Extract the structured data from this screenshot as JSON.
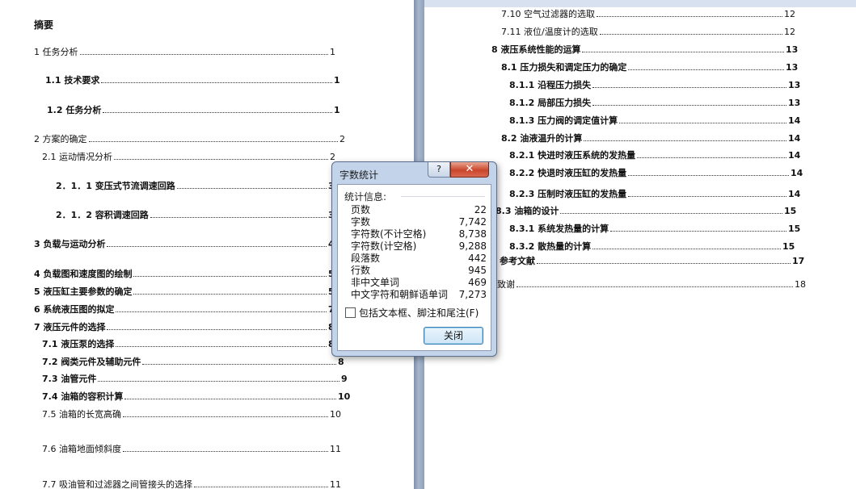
{
  "document": {
    "abstract_heading": "摘要",
    "left_entries": [
      {
        "title": "1 任务分析",
        "page": "1"
      },
      {
        "title": "1.1 技术要求",
        "page": "1"
      },
      {
        "title": "1.2  任务分析",
        "page": "1"
      },
      {
        "title": "2   方案的确定",
        "page": "2"
      },
      {
        "title": "2.1 运动情况分析",
        "page": "2"
      },
      {
        "title": "2．1．1 变压式节流调速回路",
        "page": "3"
      },
      {
        "title": "2．1．2 容积调速回路",
        "page": "3"
      },
      {
        "title": "3   负载与运动分析",
        "page": "4"
      },
      {
        "title": "4   负载图和速度图的绘制",
        "page": "5"
      },
      {
        "title": "5 液压缸主要参数的确定",
        "page": "5"
      },
      {
        "title": "6 系统液压图的拟定",
        "page": "7"
      },
      {
        "title": "7 液压元件的选择",
        "page": "8"
      },
      {
        "title": "7.1 液压泵的选择",
        "page": "8"
      },
      {
        "title": "7.2  阀类元件及辅助元件",
        "page": "8"
      },
      {
        "title": "7.3 油管元件",
        "page": "9"
      },
      {
        "title": "7.4 油箱的容积计算",
        "page": "10"
      },
      {
        "title": "7.5 油箱的长宽高确",
        "page": "10"
      },
      {
        "title": "7.6 油箱地面倾斜度",
        "page": "11"
      },
      {
        "title": "7.7 吸油管和过滤器之间管接头的选择",
        "page": "11"
      }
    ],
    "right_entries": [
      {
        "title": "7.10 空气过滤器的选取",
        "page": "12"
      },
      {
        "title": "7.11 液位/温度计的选取",
        "page": "12"
      },
      {
        "title": "8   液压系统性能的运算",
        "page": "13"
      },
      {
        "title": "8.1  压力损失和调定压力的确定",
        "page": "13"
      },
      {
        "title": "8.1.1 沿程压力损失",
        "page": "13"
      },
      {
        "title": "8.1.2 局部压力损失",
        "page": "13"
      },
      {
        "title": "8.1.3 压力阀的调定值计算",
        "page": "14"
      },
      {
        "title": "8.2 油液温升的计算",
        "page": "14"
      },
      {
        "title": "8.2.1 快进时液压系统的发热量",
        "page": "14"
      },
      {
        "title": "8.2.2 快退时液压缸的发热量",
        "page": "14"
      },
      {
        "title": "8.2.3 压制时液压缸的发热量",
        "page": "14"
      },
      {
        "title": "8.3 油箱的设计",
        "page": "15"
      },
      {
        "title": "8.3.1 系统发热量的计算",
        "page": "15"
      },
      {
        "title": "8.3.2 散热量的计算",
        "page": "15"
      },
      {
        "title": "参考文献",
        "page": "17"
      },
      {
        "title": "致谢",
        "page": "18"
      }
    ]
  },
  "dialog": {
    "title": "字数统计",
    "help_label": "?",
    "close_glyph": "✕",
    "section_label": "统计信息:",
    "stats": [
      {
        "label": "页数",
        "value": "22"
      },
      {
        "label": "字数",
        "value": "7,742"
      },
      {
        "label": "字符数(不计空格)",
        "value": "8,738"
      },
      {
        "label": "字符数(计空格)",
        "value": "9,288"
      },
      {
        "label": "段落数",
        "value": "442"
      },
      {
        "label": "行数",
        "value": "945"
      },
      {
        "label": "非中文单词",
        "value": "469"
      },
      {
        "label": "中文字符和朝鲜语单词",
        "value": "7,273"
      }
    ],
    "checkbox_label": "包括文本框、脚注和尾注(F)",
    "checkbox_checked": false,
    "ok_label": "关闭"
  }
}
